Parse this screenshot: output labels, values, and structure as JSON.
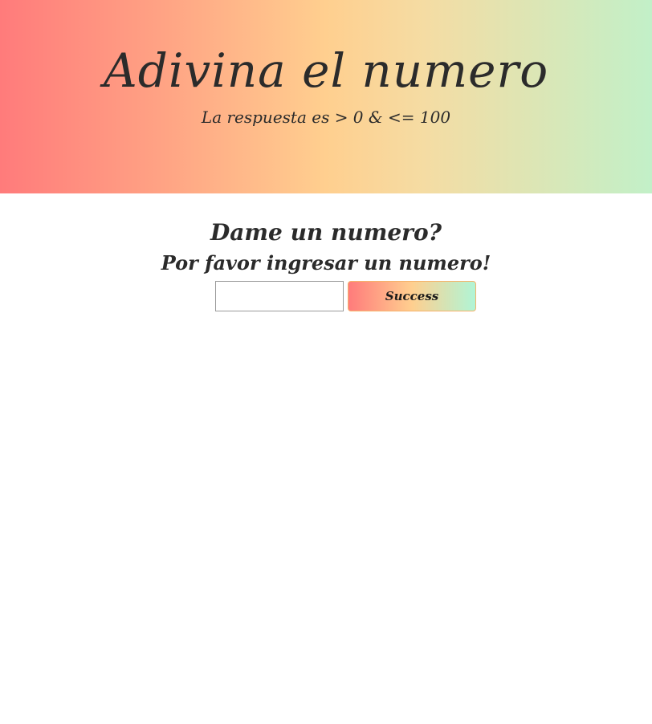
{
  "header": {
    "title": "Adivina el numero",
    "subtitle": "La respuesta es > 0 & <= 100",
    "gradient_colors": [
      "#ff7b7b",
      "#ffcf8f",
      "#c2f0c8"
    ]
  },
  "game": {
    "question": "Dame un numero?",
    "message": "Por favor ingresar un numero!",
    "input": {
      "value": "",
      "placeholder": ""
    },
    "submit_label": "Success"
  }
}
